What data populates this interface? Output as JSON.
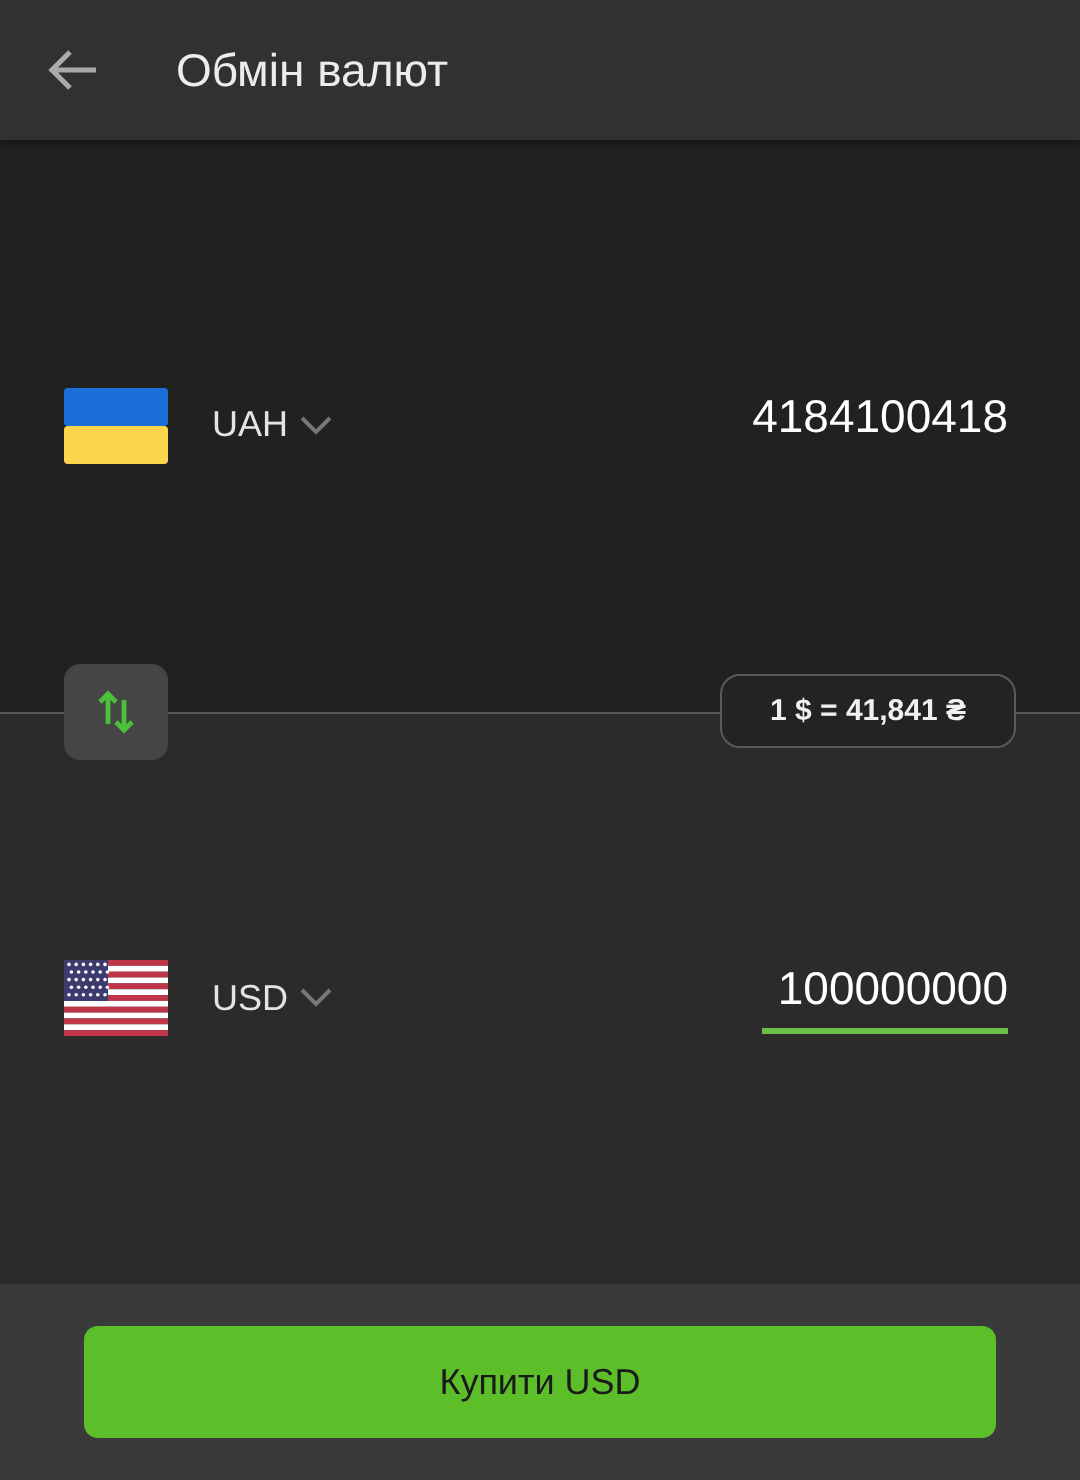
{
  "header": {
    "title": "Обмін валют"
  },
  "currencies": [
    {
      "code": "UAH",
      "kind": "uah",
      "amount": "4184100418",
      "focused": false
    },
    {
      "code": "USD",
      "kind": "usd",
      "amount": "100000000",
      "focused": true
    }
  ],
  "rate": "1 $ = 41,841 ₴",
  "buy_button": "Купити USD"
}
